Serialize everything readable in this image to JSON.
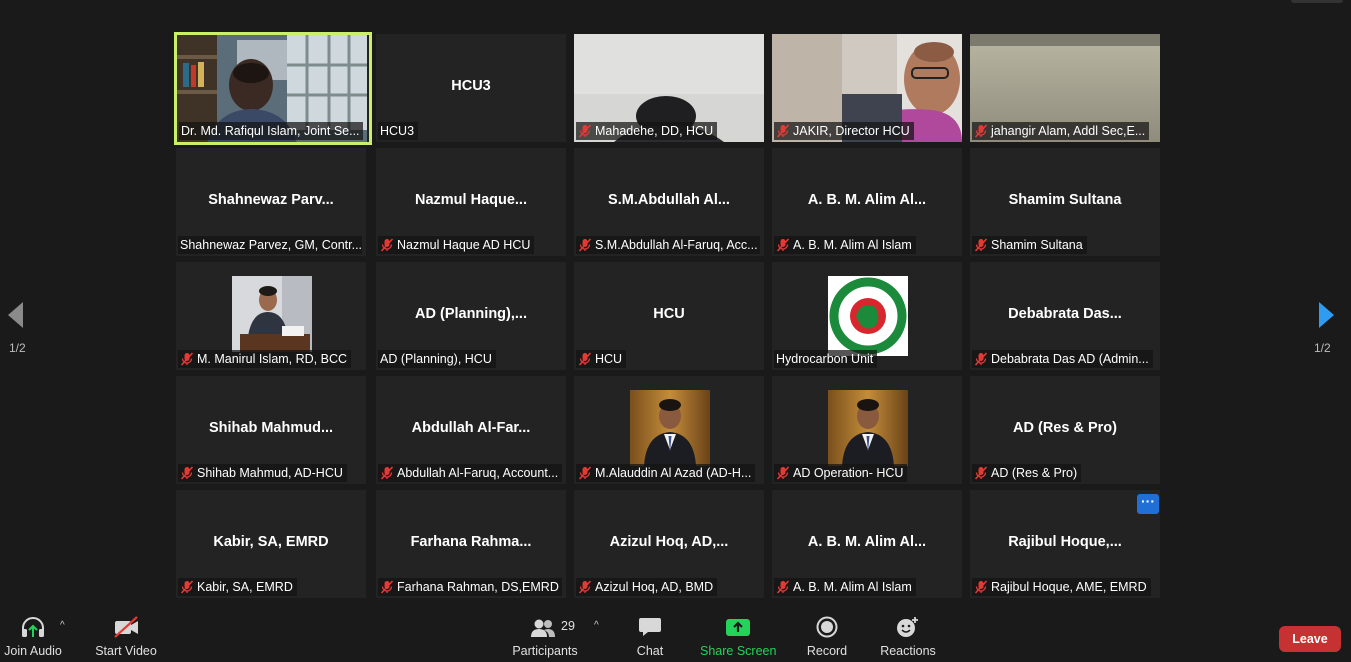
{
  "colors": {
    "background": "#1a1a1a",
    "tile": "#232323",
    "active_speaker_border": "#c9f068",
    "mute_red": "#e53935",
    "share_green": "#23d35a",
    "leave_red": "#c63232",
    "nav_blue": "#2e9cf2",
    "more_button_blue": "#1f6fd6"
  },
  "pager": {
    "left_indicator": "1/2",
    "right_indicator": "1/2",
    "left_arrow_icon": "chevron-left-icon",
    "right_arrow_icon": "chevron-right-icon"
  },
  "tiles": [
    {
      "title": "",
      "name": "Dr. Md. Rafiqul Islam, Joint Se...",
      "muted": false,
      "video": "office-photo",
      "active": true
    },
    {
      "title": "HCU3",
      "name": "HCU3",
      "muted": false
    },
    {
      "title": "",
      "name": "Mahadehe, DD, HCU",
      "muted": true,
      "video": "room-photo"
    },
    {
      "title": "",
      "name": "JAKIR, Director HCU",
      "muted": true,
      "video": "person-photo"
    },
    {
      "title": "",
      "name": "jahangir Alam, Addl Sec,E...",
      "muted": true,
      "video": "ceiling-photo"
    },
    {
      "title": "Shahnewaz  Parv...",
      "name": "Shahnewaz Parvez, GM, Contr...",
      "muted": false
    },
    {
      "title": "Nazmul  Haque...",
      "name": "Nazmul Haque AD HCU",
      "muted": true
    },
    {
      "title": "S.M.Abdullah  Al...",
      "name": "S.M.Abdullah Al-Faruq, Acc...",
      "muted": true
    },
    {
      "title": "A. B. M. Alim Al...",
      "name": "A. B. M. Alim Al Islam",
      "muted": true
    },
    {
      "title": "Shamim  Sultana",
      "name": "Shamim  Sultana",
      "muted": true
    },
    {
      "title": "",
      "name": "M. Manirul Islam, RD, BCC",
      "muted": true,
      "video": "profile-small"
    },
    {
      "title": "AD  (Planning),...",
      "name": "AD (Planning), HCU",
      "muted": false
    },
    {
      "title": "HCU",
      "name": "HCU",
      "muted": true
    },
    {
      "title": "",
      "name": "Hydrocarbon Unit",
      "muted": false,
      "video": "govt-seal"
    },
    {
      "title": "Debabrata  Das...",
      "name": "Debabrata Das AD (Admin...",
      "muted": true
    },
    {
      "title": "Shihab  Mahmud...",
      "name": "Shihab Mahmud, AD-HCU",
      "muted": true
    },
    {
      "title": "Abdullah  Al-Far...",
      "name": "Abdullah Al-Faruq, Account...",
      "muted": true
    },
    {
      "title": "",
      "name": "M.Alauddin Al Azad (AD-H...",
      "muted": true,
      "video": "profile-suit"
    },
    {
      "title": "",
      "name": "AD Operation- HCU",
      "muted": true,
      "video": "profile-suit"
    },
    {
      "title": "AD (Res & Pro)",
      "name": "AD (Res & Pro)",
      "muted": true
    },
    {
      "title": "Kabir, SA, EMRD",
      "name": "Kabir, SA, EMRD",
      "muted": true
    },
    {
      "title": "Farhana  Rahma...",
      "name": "Farhana Rahman, DS,EMRD",
      "muted": true
    },
    {
      "title": "Azizul  Hoq,  AD,...",
      "name": "Azizul Hoq, AD, BMD",
      "muted": true
    },
    {
      "title": "A. B. M. Alim Al...",
      "name": "A. B. M. Alim Al Islam",
      "muted": true
    },
    {
      "title": "Rajibul  Hoque,...",
      "name": "Rajibul Hoque, AME, EMRD",
      "muted": true,
      "more_button": true
    }
  ],
  "more_button_label": "···",
  "toolbar": {
    "join_audio": {
      "label": "Join Audio",
      "icon": "headphones-icon"
    },
    "start_video": {
      "label": "Start Video",
      "icon": "camera-off-icon"
    },
    "participants": {
      "label": "Participants",
      "count": "29",
      "icon": "people-icon"
    },
    "chat": {
      "label": "Chat",
      "icon": "chat-icon"
    },
    "share_screen": {
      "label": "Share Screen",
      "icon": "share-arrow-icon"
    },
    "record": {
      "label": "Record",
      "icon": "record-icon"
    },
    "reactions": {
      "label": "Reactions",
      "icon": "smiley-icon"
    },
    "caret": "^",
    "leave": "Leave"
  }
}
